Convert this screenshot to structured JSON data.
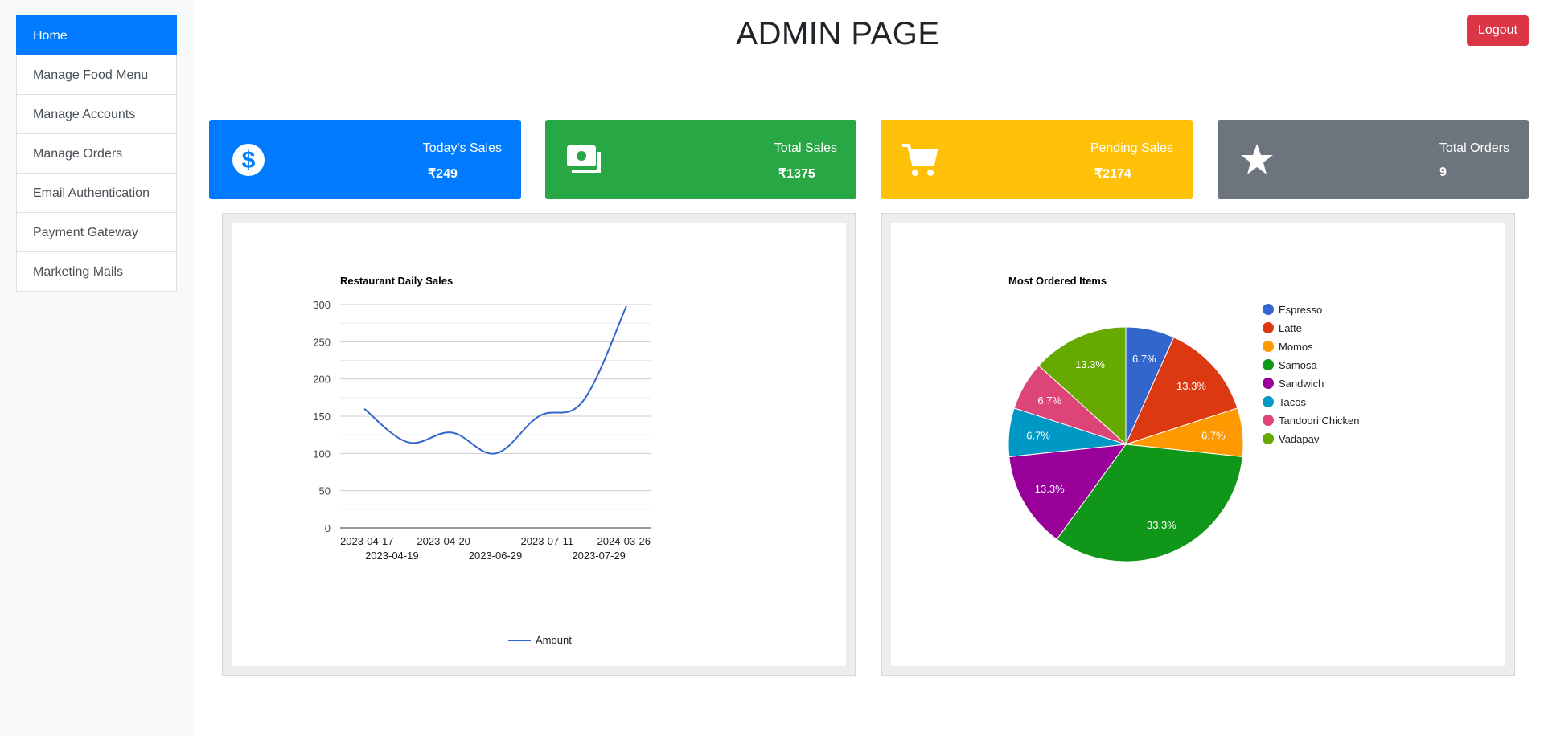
{
  "sidebar": {
    "items": [
      {
        "label": "Home",
        "active": true
      },
      {
        "label": "Manage Food Menu"
      },
      {
        "label": "Manage Accounts"
      },
      {
        "label": "Manage Orders"
      },
      {
        "label": "Email Authentication"
      },
      {
        "label": "Payment Gateway"
      },
      {
        "label": "Marketing Mails"
      }
    ]
  },
  "header": {
    "title": "ADMIN PAGE",
    "logout_label": "Logout"
  },
  "cards": [
    {
      "label": "Today's Sales",
      "value": "₹249",
      "icon": "dollar-circle-icon",
      "color": "#007bff"
    },
    {
      "label": "Total Sales",
      "value": "₹1375",
      "icon": "money-bills-icon",
      "color": "#28a745"
    },
    {
      "label": "Pending Sales",
      "value": "₹2174",
      "icon": "shopping-cart-icon",
      "color": "#ffc107"
    },
    {
      "label": "Total Orders",
      "value": "9",
      "icon": "star-icon",
      "color": "#6c757d"
    }
  ],
  "chart_data": [
    {
      "type": "line",
      "title": "Restaurant Daily Sales",
      "x": [
        "2023-04-17",
        "2023-04-19",
        "2023-04-20",
        "2023-06-29",
        "2023-07-11",
        "2023-07-29",
        "2024-03-26"
      ],
      "series": [
        {
          "name": "Amount",
          "values": [
            160,
            115,
            128,
            100,
            150,
            170,
            298
          ],
          "color": "#3366cc"
        }
      ],
      "ylim": [
        0,
        300
      ],
      "yticks": [
        0,
        50,
        100,
        150,
        200,
        250,
        300
      ],
      "grid": true,
      "legend": "bottom"
    },
    {
      "type": "pie",
      "title": "Most Ordered Items",
      "labels": [
        "Espresso",
        "Latte",
        "Momos",
        "Samosa",
        "Sandwich",
        "Tacos",
        "Tandoori Chicken",
        "Vadapav"
      ],
      "values": [
        6.7,
        13.3,
        6.7,
        33.3,
        13.3,
        6.7,
        6.7,
        13.3
      ],
      "slice_labels": [
        "6.7%",
        "13.3%",
        "6.7%",
        "33.3%",
        "13.3%",
        "6.7%",
        "6.7%",
        "13.3%"
      ],
      "colors": [
        "#3366cc",
        "#dc3912",
        "#ff9900",
        "#109618",
        "#990099",
        "#0099c6",
        "#dd4477",
        "#66aa00"
      ],
      "legend": "right"
    }
  ]
}
